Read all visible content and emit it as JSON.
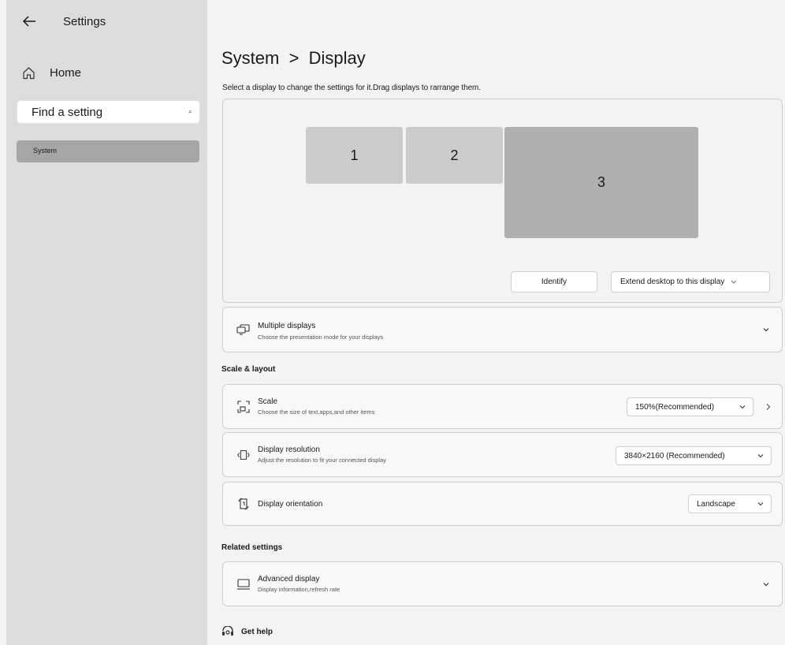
{
  "app": {
    "title": "Settings"
  },
  "sidebar": {
    "home_label": "Home",
    "search_placeholder": "Find a setting",
    "nav_items": [
      {
        "label": "System",
        "selected": true
      }
    ]
  },
  "main": {
    "breadcrumb": "System  >  Display",
    "subtitle": "Select a display to change the settings for it.Drag displays to rarrange them.",
    "monitors": [
      {
        "label": "1"
      },
      {
        "label": "2"
      },
      {
        "label": "3",
        "selected": true
      }
    ],
    "identify_label": "Identify",
    "extend_label": "Extend desktop to this display",
    "multiple_displays": {
      "title": "Multiple displays",
      "description": "Choose the presentation mode for your displays"
    },
    "scale_layout_heading": "Scale & layout",
    "scale": {
      "title": "Scale",
      "description": "Choose the size of text,apps,and other items",
      "value": "150%(Recommended)"
    },
    "resolution": {
      "title": "Display resolution",
      "description": "Adjust the resolution to fit your connected display",
      "value": "3840×2160 (Recommended)"
    },
    "orientation": {
      "title": "Display orientation",
      "value": "Landscape"
    },
    "related_heading": "Related settings",
    "advanced": {
      "title": "Advanced display",
      "description": "Display information,refresh rate"
    },
    "help_label": "Get help"
  },
  "icons": [
    "back-arrow-icon",
    "home-icon",
    "search-icon",
    "multiple-displays-icon",
    "scale-icon",
    "resolution-icon",
    "orientation-icon",
    "monitor-icon",
    "help-icon",
    "chevron-down-icon",
    "chevron-right-icon"
  ],
  "colors": {
    "sidebar_bg": "#dcdcdc",
    "page_bg": "#f3f3f3",
    "selected_nav": "#a6a6a6",
    "monitor": "#cccccc",
    "monitor_selected": "#b0b0b0"
  }
}
